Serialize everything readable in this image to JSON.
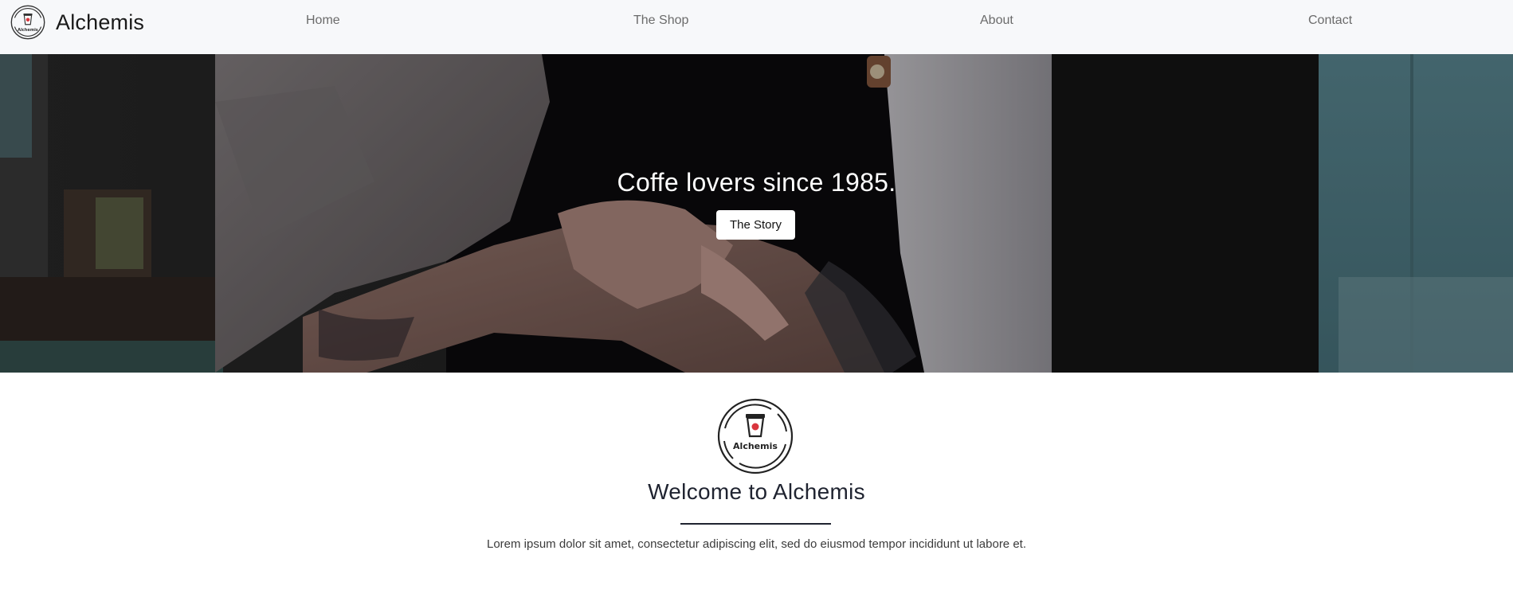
{
  "navbar": {
    "brand_name": "Alchemis",
    "logo_text": "Alchemis",
    "links": [
      {
        "label": "Home"
      },
      {
        "label": "The Shop"
      },
      {
        "label": "About"
      },
      {
        "label": "Contact"
      }
    ]
  },
  "hero": {
    "title": "Coffe lovers since 1985.",
    "button_label": "The Story"
  },
  "welcome": {
    "logo_text": "Alchemis",
    "title": "Welcome to Alchemis",
    "text": "Lorem ipsum dolor sit amet, consectetur adipiscing elit, sed do eiusmod tempor incididunt ut labore et."
  },
  "colors": {
    "navbar_bg": "#f7f8fa",
    "hero_text": "#ffffff",
    "heading": "#1f2330",
    "nav_link": "#6b6b6b",
    "logo_accent": "#d9363e"
  },
  "icons": {
    "brand_logo": "coffee-cup-logo-icon",
    "welcome_logo": "coffee-cup-logo-icon"
  }
}
